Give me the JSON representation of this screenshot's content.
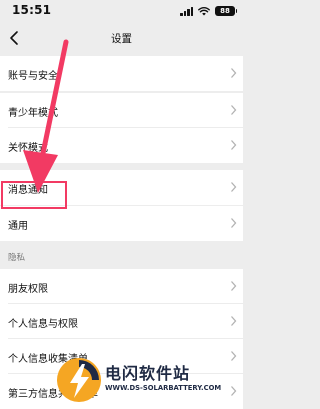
{
  "status_bar": {
    "time": "15:51",
    "battery": "88"
  },
  "nav": {
    "title": "设置"
  },
  "rows": [
    {
      "label": "账号与安全"
    },
    {
      "label": "青少年模式"
    },
    {
      "label": "关怀模式"
    },
    {
      "label": "消息通知"
    },
    {
      "label": "通用"
    },
    {
      "label": "朋友权限"
    },
    {
      "label": "个人信息与权限"
    },
    {
      "label": "个人信息收集清单"
    },
    {
      "label": "第三方信息共享清单"
    }
  ],
  "section_privacy": "隐私",
  "watermark": {
    "brand": "电闪软件站",
    "url": "WWW.DS-SOLARBATTERY.COM"
  },
  "colors": {
    "annotation": "#f23a63",
    "background": "#ededed",
    "watermark_orange": "#f5a623",
    "watermark_navy": "#1f2a44"
  },
  "icons": [
    "back-icon",
    "chevron-right-icon",
    "wifi-icon",
    "signal-icon",
    "battery-icon",
    "lightning-logo-icon"
  ]
}
